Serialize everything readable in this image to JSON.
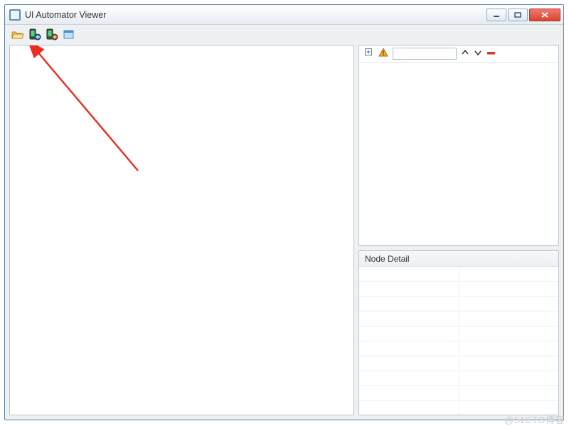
{
  "window": {
    "title": "UI Automator Viewer"
  },
  "toolbar": {
    "open": "open",
    "screenshot": "device-screenshot",
    "screenshot_compressed": "device-screenshot-compressed",
    "clear": "clear"
  },
  "tree_panel": {
    "expand_all": "expand-all",
    "toggle_naf": "toggle-naf-nodes",
    "search_value": "",
    "search_placeholder": "",
    "prev": "previous",
    "next": "next",
    "delete": "delete"
  },
  "details": {
    "title": "Node Detail"
  },
  "watermark": "@51CTO博客"
}
